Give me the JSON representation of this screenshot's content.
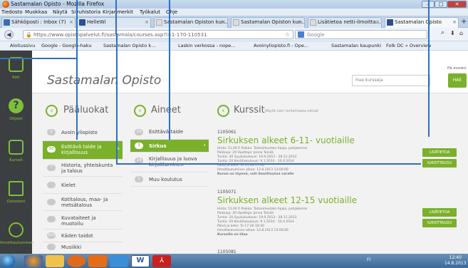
{
  "window": {
    "title": "Sastamalan Opisto - Mozilla Firefox",
    "controls": [
      "minimize",
      "maximize",
      "close"
    ]
  },
  "menu": [
    "Tiedosto",
    "Muokkaa",
    "Näytä",
    "Sivuhistoria",
    "Kirjanmerkit",
    "Työkalut",
    "Ohje"
  ],
  "tabs": [
    {
      "label": "Sähköposti : Inbox (7)",
      "icon": "mail-icon",
      "color": "#3b6fb5"
    },
    {
      "label": "HelleWi",
      "icon": "h-icon",
      "color": "#2b4f8f"
    },
    {
      "label": "Sastamalan Opiston kur...",
      "icon": "page-icon",
      "color": "#cccccc"
    },
    {
      "label": "Sastamalan Opiston kur...",
      "icon": "page-icon",
      "color": "#cccccc"
    },
    {
      "label": "Lisätietoa netti-ilmoitta...",
      "icon": "page-icon",
      "color": "#cccccc"
    },
    {
      "label": "Sastamalan Opisto",
      "icon": "h-icon",
      "color": "#2b4f8f"
    }
  ],
  "url": "https://www.opistopalvelut.fi/sastamala/courses.asp?l=1-170-110531",
  "search_placeholder": "Google",
  "bookmarks": [
    "Aloitussivu",
    "Google - Google-haku",
    "Sastamalan Opisto k...",
    "Laskin verkossa - nope...",
    "Avoinyliopisto.fi - Ope...",
    "Sastamalan kaupunki",
    "Folk DC » Overview"
  ],
  "sidebar": [
    {
      "label": "Koti",
      "icon": "home-icon"
    },
    {
      "label": "Ohjeet",
      "icon": "help-icon"
    },
    {
      "label": "Kurssit",
      "icon": "book-icon"
    },
    {
      "label": "Ostoskori",
      "icon": "cart-icon"
    },
    {
      "label": "Ilmoittautuminen",
      "icon": "signup-icon"
    }
  ],
  "header": {
    "brand": "Sastamalan Opisto",
    "search_placeholder": "Hae kursseja",
    "search_button": "HAE",
    "notice": "Pä evosto"
  },
  "paaluokat": {
    "title": "Pääluokat",
    "items": [
      {
        "n": "3",
        "label": "Avoin yliopisto"
      },
      {
        "n": "30",
        "label": "Esittävä taide ja kirjallisuus",
        "selected": true
      },
      {
        "n": "7",
        "label": "Historia, yhteiskunta ja talous"
      },
      {
        "n": "",
        "label": "Kielet"
      },
      {
        "n": "",
        "label": "Kotitalous, maa- ja metsätalous"
      },
      {
        "n": "",
        "label": "Kuvataiteet ja muotoilu"
      },
      {
        "n": "102",
        "label": "Käden taidot"
      },
      {
        "n": "",
        "label": "Musiikki"
      },
      {
        "n": "",
        "label": "Muut taidot"
      }
    ]
  },
  "aineet": {
    "title": "Aineet",
    "items": [
      {
        "n": "14",
        "label": "Esittävä taide"
      },
      {
        "n": "3",
        "label": "Sirkus",
        "selected": true
      },
      {
        "n": "14",
        "label": "Kirjallisuus ja luova kirjoittaminen"
      },
      {
        "n": "1",
        "label": "Muu koulutus"
      }
    ]
  },
  "kurssit": {
    "title": "Kurssit",
    "subtitle": "Näytä vain tuntemassa olevat",
    "courses": [
      {
        "code": "1105061",
        "name": "Sirkuksen alkeet 6-11- vuotiaille",
        "lines": [
          "Hinta: 51,00 €      Paikka: Taitosirkustalo Apaja, pohjakerros",
          "Paikkoja: 20       Opettaja: Jenna Teinilä",
          "Tuntia: 20         Syyslukukausi: 19.9.2013 - 28.11.2013",
          "Tuntia: 20         Kevätlukukausi: 9.1.2014 - 10.4.2014",
          "Päivä ja kello: To 15:30-17:00",
          "Ilmoittautuminen alkaa: 12.8.2013 13:00:00",
          "Kurssi on täynnä, voit ilmoittautua varalle"
        ]
      },
      {
        "code": "1105071",
        "name": "Sirkuksen alkeet 12-15 vuotiaille",
        "lines": [
          "Hinta: 51,00 €      Paikka: Taitosirkustalo Apaja, pohjakerros",
          "Paikkoja: 20       Opettaja: Jenna Teinilä",
          "Tuntia: 20         Syyslukukausi: 19.9.2013 - 28.11.2013",
          "Tuntia: 20         Kevätlukukausi: 9.1.2014 - 10.4.2014",
          "Päivä ja kello: To 17:30-18:30",
          "Ilmoittautuminen alkaa: 12.8.2013 13:00:00",
          "Kurssilla on tilaa"
        ]
      },
      {
        "code": "1105081",
        "name": "",
        "lines": []
      }
    ],
    "btn_info": "LISÄTIETOA",
    "btn_signup": "ILMOITTAUDU"
  },
  "taskbar": {
    "time": "12:40",
    "date": "14.8.2013",
    "tray": "FI"
  }
}
